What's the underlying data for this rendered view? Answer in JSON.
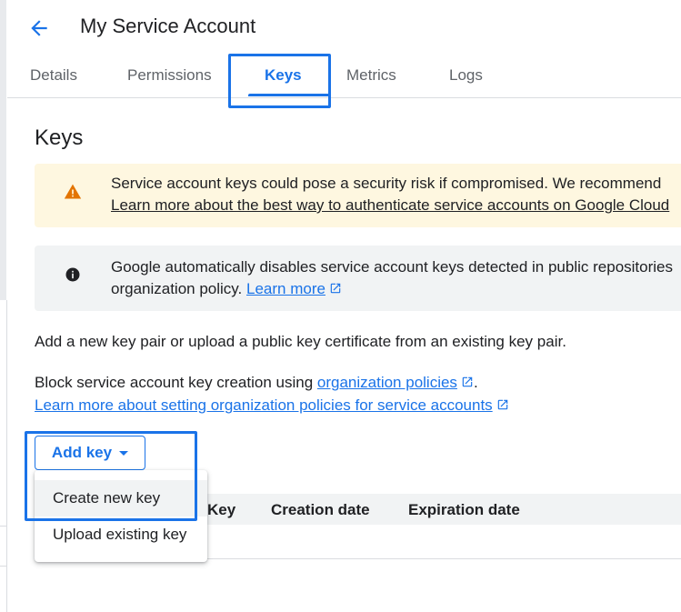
{
  "header": {
    "title": "My Service Account"
  },
  "tabs": [
    {
      "label": "Details"
    },
    {
      "label": "Permissions"
    },
    {
      "label": "Keys",
      "active": true
    },
    {
      "label": "Metrics"
    },
    {
      "label": "Logs"
    }
  ],
  "section": {
    "title": "Keys"
  },
  "warning_banner": {
    "icon": "warning-icon",
    "line1": "Service account keys could pose a security risk if compromised. We recommend",
    "line2": "Learn more about the best way to authenticate service accounts on Google Cloud",
    "color": "#fef7e0"
  },
  "info_banner": {
    "icon": "info-icon",
    "line1": "Google automatically disables service account keys detected in public repositories",
    "line2_prefix": "organization policy.",
    "link": "Learn more",
    "color": "#f1f3f4"
  },
  "description": "Add a new key pair or upload a public key certificate from an existing key pair.",
  "policy": {
    "prefix": "Block service account key creation using",
    "link": "organization policies",
    "suffix": ".",
    "learn_more": "Learn more about setting organization policies for service accounts"
  },
  "add_key": {
    "label": "Add key",
    "menu": [
      {
        "label": "Create new key"
      },
      {
        "label": "Upload existing key"
      }
    ]
  },
  "table": {
    "columns": [
      "Key",
      "Creation date",
      "Expiration date"
    ]
  },
  "colors": {
    "accent": "#1a73e8",
    "warning": "#e37400"
  }
}
